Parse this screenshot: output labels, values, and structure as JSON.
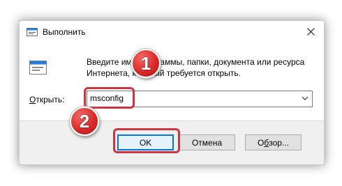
{
  "dialog": {
    "title": "Выполнить",
    "description": "Введите имя программы, папки, документа или ресурса Интернета, который требуется открыть.",
    "open_label_prefix": "",
    "open_label_accel": "О",
    "open_label_rest": "ткрыть:",
    "input_value": "msconfig",
    "ok_label": "OK",
    "cancel_label": "Отмена",
    "browse_label_accel": "б",
    "browse_label_pre": "О",
    "browse_label_post": "зор..."
  },
  "annotations": {
    "step1": "1",
    "step2": "2",
    "highlight_color": "#d03440"
  },
  "icons": {
    "title": "run-icon",
    "big": "run-icon",
    "close": "close-icon",
    "dropdown": "chevron-down-icon"
  }
}
